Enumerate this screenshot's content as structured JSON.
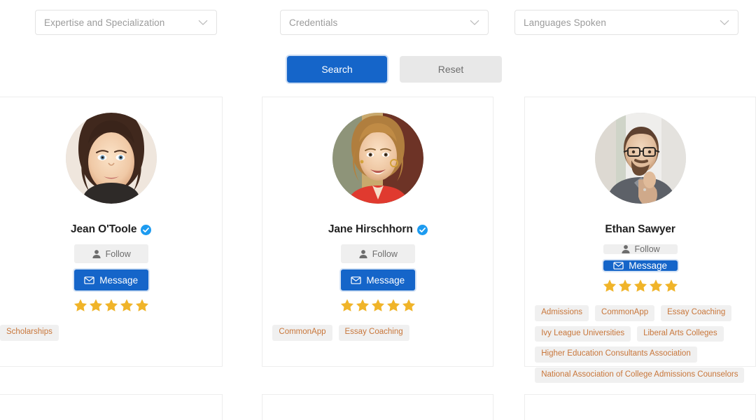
{
  "filters": [
    {
      "id": "expertise",
      "placeholder": "Expertise and Specialization",
      "value": ""
    },
    {
      "id": "credentials",
      "placeholder": "Credentials",
      "value": ""
    },
    {
      "id": "languages",
      "placeholder": "Languages Spoken",
      "value": ""
    }
  ],
  "actions": {
    "search_label": "Search",
    "reset_label": "Reset"
  },
  "labels": {
    "follow": "Follow",
    "message": "Message"
  },
  "colors": {
    "primary": "#1565c9",
    "star": "#f0b429",
    "tag_text": "#c8763a",
    "tag_bg": "#f0f0f0",
    "verified_badge": "#1d9bf0",
    "placeholder_text": "#9b9b9b"
  },
  "counselors": [
    {
      "name": "Jean O'Toole",
      "verified": true,
      "rating": 5,
      "avatar_alt": "woman-portrait-dark-hair",
      "tags": [
        "Scholarships"
      ]
    },
    {
      "name": "Jane Hirschhorn",
      "verified": true,
      "rating": 5,
      "avatar_alt": "woman-portrait-blonde-red-jacket",
      "tags": [
        "CommonApp",
        "Essay Coaching"
      ]
    },
    {
      "name": "Ethan Sawyer",
      "verified": false,
      "rating": 5,
      "avatar_alt": "man-portrait-glasses-beard",
      "tags": [
        "Admissions",
        "CommonApp",
        "Essay Coaching",
        "Ivy League Universities",
        "Liberal Arts Colleges",
        "Higher Education Consultants Association",
        "National Association of College Admissions Counselors"
      ]
    }
  ]
}
